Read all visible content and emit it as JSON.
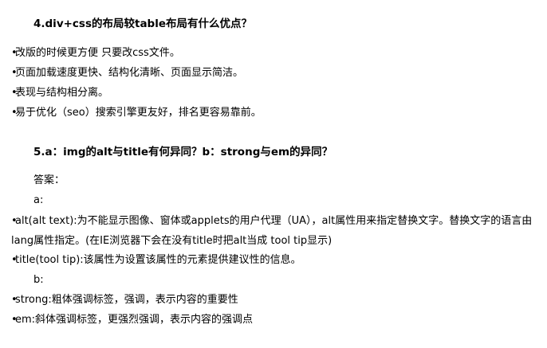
{
  "section4": {
    "title": "4.div+css的布局较table布局有什么优点？",
    "points": [
      "改版的时候更方便 只要改css文件。",
      "页面加载速度更快、结构化清晰、页面显示简洁。",
      "表现与结构相分离。",
      "易于优化（seo）搜索引擎更友好，排名更容易靠前。"
    ]
  },
  "section5": {
    "title": "5.a：img的alt与title有何异同？b：strong与em的异同？",
    "answer_label": "答案：",
    "part_a_label": "a:",
    "alt_text": "alt(alt text):为不能显示图像、窗体或applets的用户代理（UA），alt属性用来指定替换文字。替换文字的语言由lang属性指定。(在IE浏览器下会在没有title时把alt当成 tool tip显示)",
    "title_text": "title(tool tip):该属性为设置该属性的元素提供建议性的信息。",
    "part_b_label": "b:",
    "strong_text": "strong:粗体强调标签，强调，表示内容的重要性",
    "em_text": "em:斜体强调标签，更强烈强调，表示内容的强调点"
  }
}
